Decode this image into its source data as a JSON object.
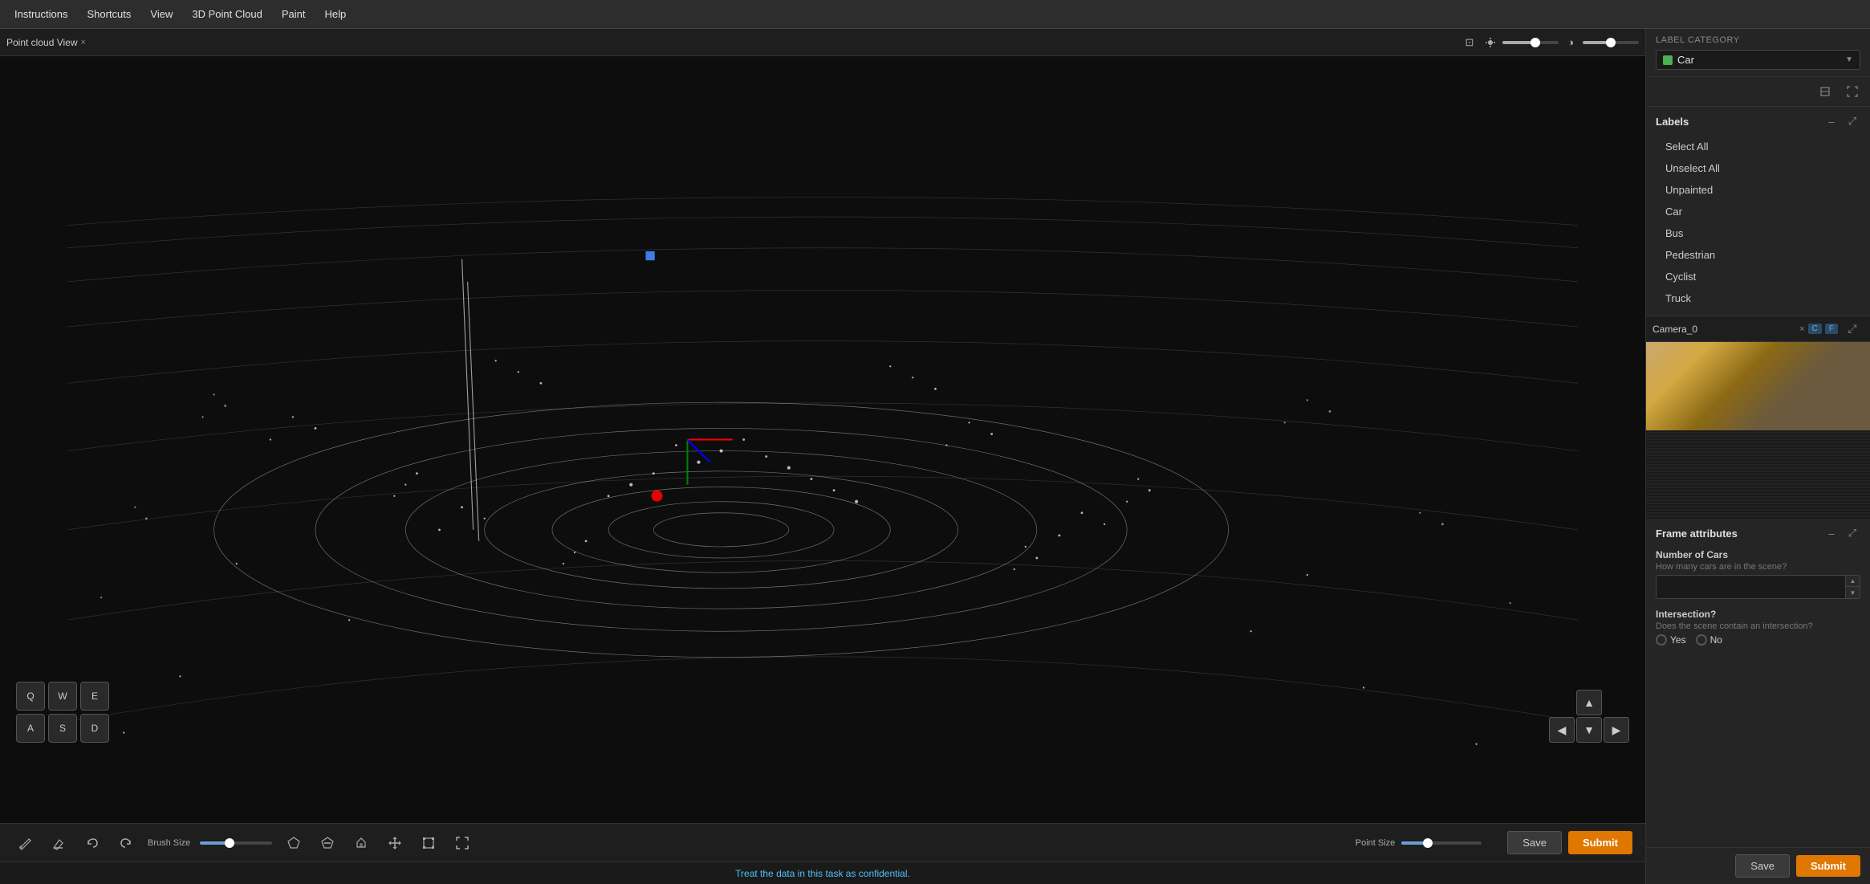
{
  "menubar": {
    "items": [
      "Instructions",
      "Shortcuts",
      "View",
      "3D Point Cloud",
      "Paint",
      "Help"
    ]
  },
  "pointcloud": {
    "tab_label": "Point cloud View",
    "tab_close": "×",
    "brightness_icon": "☀",
    "contrast_icon": "◑"
  },
  "camera": {
    "label": "Camera_0",
    "close": "×",
    "badge_c": "C",
    "badge_f": "F"
  },
  "labels": {
    "section_title": "Labels",
    "select_all": "Select All",
    "unselect_all": "Unselect All",
    "unpainted": "Unpainted",
    "items": [
      "Car",
      "Bus",
      "Pedestrian",
      "Cyclist",
      "Truck"
    ]
  },
  "label_category": {
    "title": "Label category",
    "selected": "Car",
    "color": "#4CAF50"
  },
  "frame_attributes": {
    "title": "Frame attributes",
    "number_of_cars_label": "Number of Cars",
    "number_of_cars_desc": "How many cars are in the scene?",
    "intersection_label": "Intersection?",
    "intersection_desc": "Does the scene contain an intersection?",
    "yes": "Yes",
    "no": "No"
  },
  "bottom_toolbar": {
    "brush_size_label": "Brush Size",
    "point_size_label": "Point Size",
    "tools": [
      {
        "name": "paint-brush",
        "icon": "✏",
        "active": false
      },
      {
        "name": "erase",
        "icon": "⌫",
        "active": false
      },
      {
        "name": "undo",
        "icon": "↩",
        "active": false
      },
      {
        "name": "redo",
        "icon": "↪",
        "active": false
      },
      {
        "name": "polygon",
        "icon": "⬡",
        "active": false
      },
      {
        "name": "polygon-minus",
        "icon": "⬡",
        "active": false
      },
      {
        "name": "paint-fill",
        "icon": "🖌",
        "active": false
      },
      {
        "name": "move",
        "icon": "✛",
        "active": false
      },
      {
        "name": "transform",
        "icon": "⬚",
        "active": false
      },
      {
        "name": "fullscreen",
        "icon": "⤢",
        "active": false
      }
    ]
  },
  "actions": {
    "save": "Save",
    "submit": "Submit"
  },
  "status_bar": {
    "message": "Treat the data in this task as confidential."
  },
  "nav_keys": {
    "row1": [
      "Q",
      "W",
      "E"
    ],
    "row2": [
      "A",
      "S",
      "D"
    ]
  }
}
